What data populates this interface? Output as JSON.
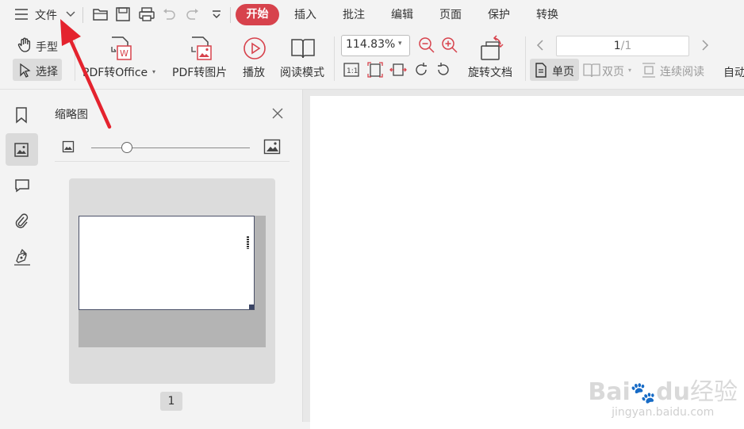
{
  "menu": {
    "file_label": "文件"
  },
  "tabs": [
    {
      "label": "开始",
      "active": true
    },
    {
      "label": "插入"
    },
    {
      "label": "批注"
    },
    {
      "label": "编辑"
    },
    {
      "label": "页面"
    },
    {
      "label": "保护"
    },
    {
      "label": "转换"
    }
  ],
  "ribbon": {
    "hand": "手型",
    "select": "选择",
    "pdf_to_office": "PDF转Office",
    "pdf_to_image": "PDF转图片",
    "play": "播放",
    "read_mode": "阅读模式",
    "zoom_value": "114.83%",
    "rotate_doc": "旋转文档",
    "page_value": "1",
    "page_total": "/1",
    "single_page": "单页",
    "double_page": "双页",
    "continuous": "连续阅读",
    "auto": "自动"
  },
  "panel": {
    "title": "缩略图",
    "page_number": "1"
  },
  "watermark": {
    "brand": "Bai",
    "brand2": "du",
    "cn": "经验",
    "url": "jingyan.baidu.com"
  },
  "colors": {
    "accent": "#d7424c",
    "arrow": "#e4232e"
  }
}
